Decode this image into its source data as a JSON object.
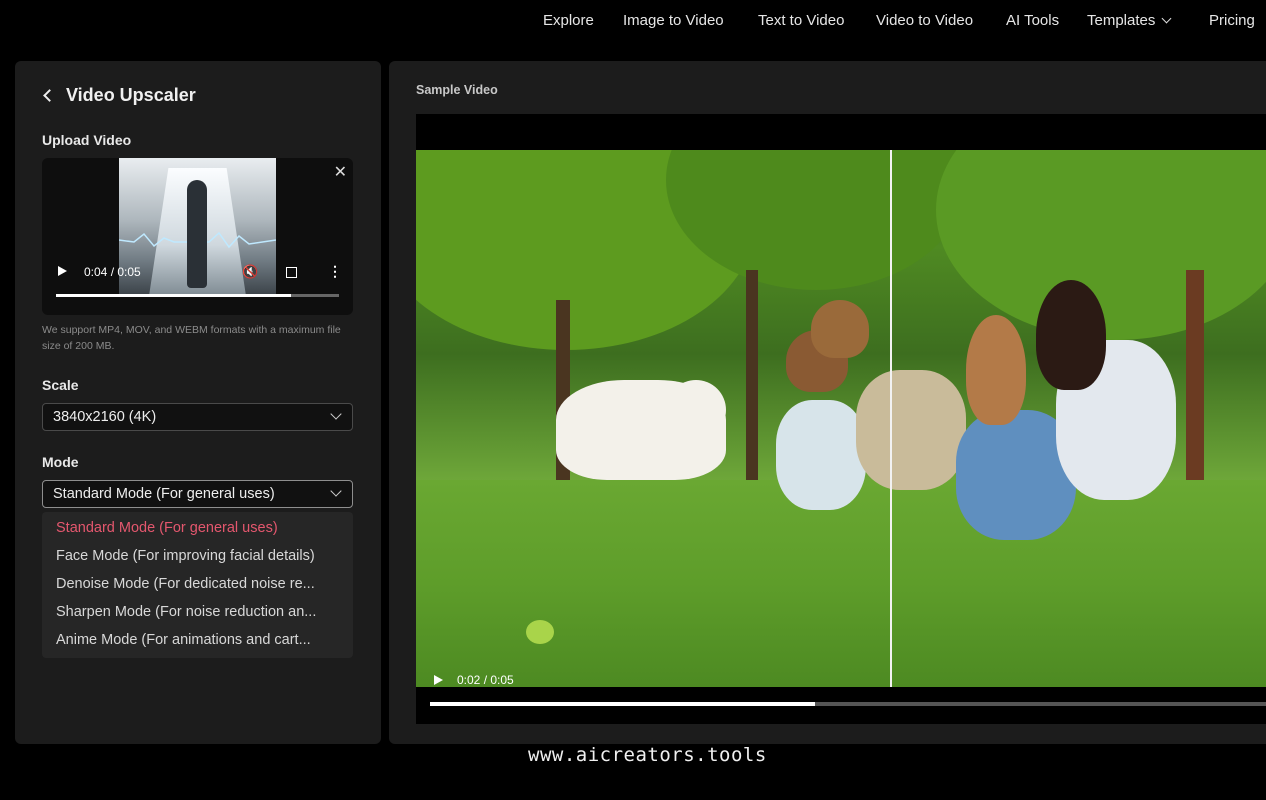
{
  "nav": {
    "items": [
      "Explore",
      "Image to Video",
      "Text to Video",
      "Video to Video",
      "AI Tools",
      "Templates",
      "Pricing"
    ]
  },
  "left": {
    "title": "Video Upscaler",
    "upload_label": "Upload Video",
    "video_time": "0:04 / 0:05",
    "video_progress": 0.83,
    "hint": "We support MP4, MOV, and WEBM formats with a maximum file size of 200 MB.",
    "scale_label": "Scale",
    "scale_value": "3840x2160 (4K)",
    "mode_label": "Mode",
    "mode_value": "Standard Mode (For general uses)",
    "mode_options": [
      "Standard Mode (For general uses)",
      "Face Mode (For improving facial details)",
      "Denoise Mode (For dedicated noise re...",
      "Sharpen Mode (For noise reduction an...",
      "Anime Mode (For animations and cart..."
    ]
  },
  "right": {
    "sample_label": "Sample Video",
    "video_time": "0:02 / 0:05",
    "video_progress": 0.46
  },
  "watermark": "www.aicreators.tools",
  "colors": {
    "selected_option": "#e4576e",
    "panel_bg": "#1c1c1c"
  }
}
